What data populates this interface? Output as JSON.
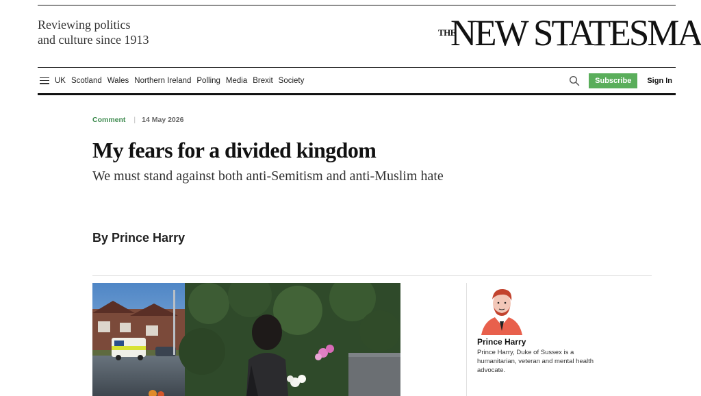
{
  "header": {
    "tagline_line1": "Reviewing politics",
    "tagline_line2": "and culture since 1913",
    "masthead_the": "THE",
    "masthead_name": "NEW STATESMAN"
  },
  "nav": {
    "items": [
      "UK",
      "Scotland",
      "Wales",
      "Northern Ireland",
      "Polling",
      "Media",
      "Brexit",
      "Society"
    ],
    "subscribe_label": "Subscribe",
    "signin_label": "Sign In"
  },
  "article": {
    "section": "Comment",
    "date": "14 May 2026",
    "headline": "My fears for a divided kingdom",
    "standfirst": "We must stand against both anti-Semitism and anti-Muslim hate",
    "byline_prefix": "By",
    "author": "Prince Harry"
  },
  "author_card": {
    "name": "Prince Harry",
    "bio": "Prince Harry, Duke of Sussex is a humanitarian, veteran and mental health advocate."
  },
  "colors": {
    "brand_green": "#5aae5b",
    "section_green": "#3d8a4e",
    "avatar_accent": "#e8604c"
  },
  "icons": [
    "menu-icon",
    "search-icon"
  ]
}
